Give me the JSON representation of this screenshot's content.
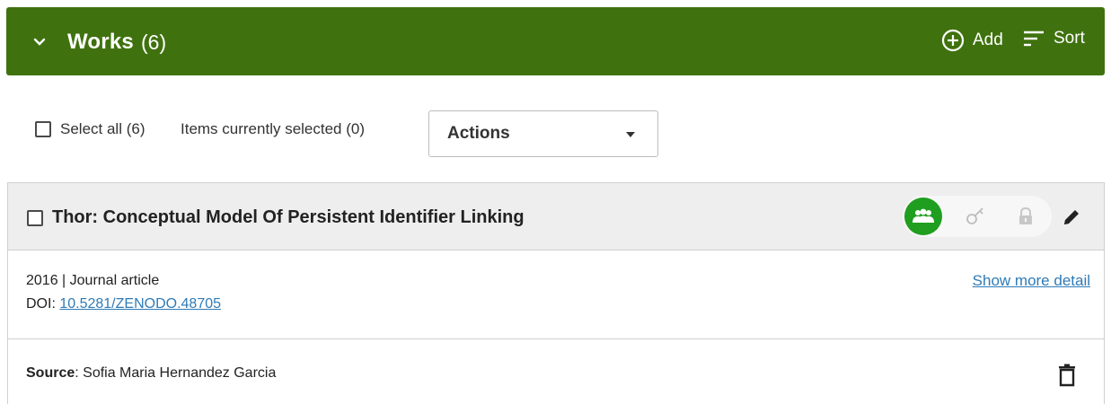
{
  "header": {
    "title": "Works",
    "count": "(6)",
    "add_label": "Add",
    "sort_label": "Sort",
    "background_color": "#3f720e"
  },
  "toolbar": {
    "select_all_label": "Select all (6)",
    "selected_status": "Items currently selected (0)",
    "actions_label": "Actions"
  },
  "work": {
    "title": "Thor: Conceptual Model Of Persistent Identifier Linking",
    "meta": "2016 | Journal article",
    "doi_label": "DOI: ",
    "doi_value": "10.5281/ZENODO.48705",
    "show_more_label": "Show more detail",
    "source_label": "Source",
    "source_value": "Sofia Maria Hernandez Garcia",
    "privacy": {
      "selected": "everyone",
      "options": [
        "everyone-icon",
        "trusted-parties-icon",
        "only-me-icon"
      ],
      "active_color": "#1f9e1f"
    }
  },
  "icons": {
    "collapse": "chevron-down-icon",
    "add": "plus-circle-icon",
    "sort": "sort-icon",
    "edit": "pencil-icon",
    "delete": "trash-icon"
  },
  "colors": {
    "link": "#2e7bb7"
  }
}
